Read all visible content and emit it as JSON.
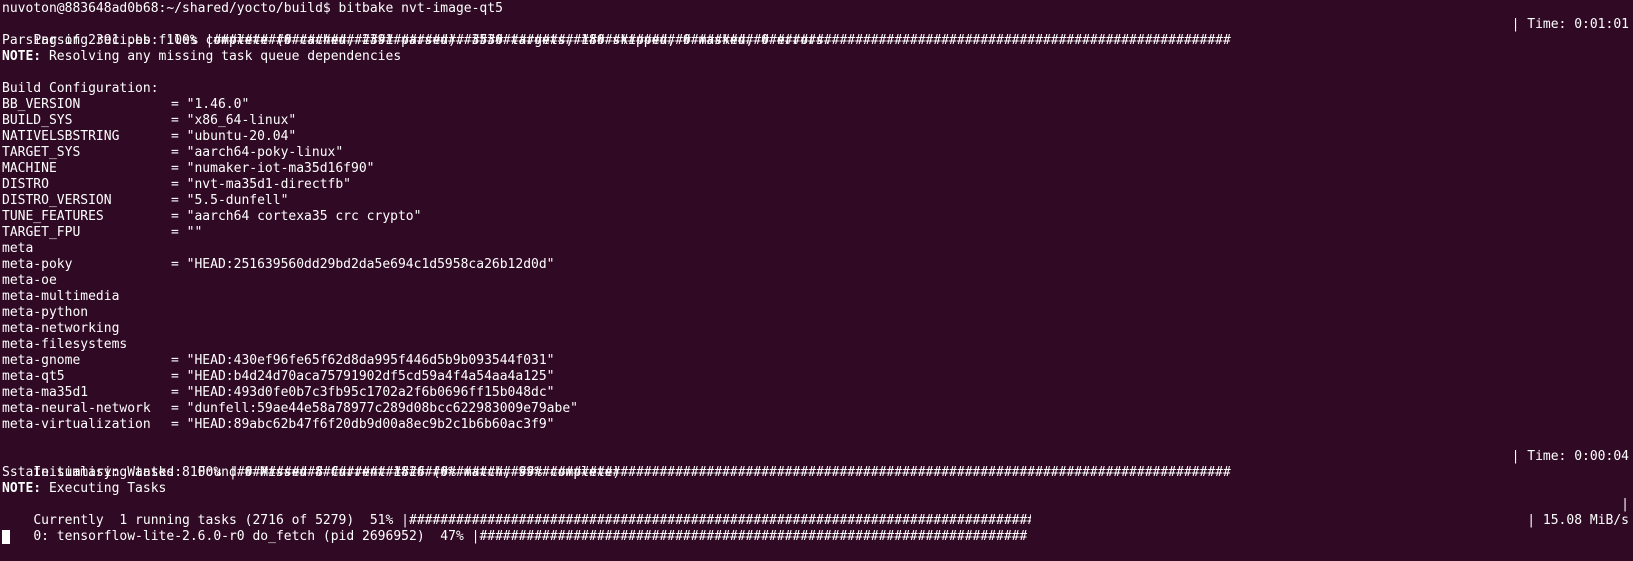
{
  "colors": {
    "background": "#300a24",
    "foreground": "#ffffff"
  },
  "prompt": "nuvoton@883648ad0b68:~/shared/yocto/build$ bitbake nvt-image-qt5",
  "parsing": {
    "label": "Parsing recipes: 100% |",
    "hashes": "##################################################################################################################################",
    "time": "| Time: 0:01:01"
  },
  "parse_summary": "Parsing of 2391 .bb files complete (0 cached, 2391 parsed). 3530 targets, 180 skipped, 0 masked, 0 errors.",
  "note1": {
    "label": "NOTE:",
    "text": " Resolving any missing task queue dependencies"
  },
  "build_config_title": "Build Configuration:",
  "config": [
    {
      "key": "BB_VERSION",
      "value": "= \"1.46.0\""
    },
    {
      "key": "BUILD_SYS",
      "value": "= \"x86_64-linux\""
    },
    {
      "key": "NATIVELSBSTRING",
      "value": "= \"ubuntu-20.04\""
    },
    {
      "key": "TARGET_SYS",
      "value": "= \"aarch64-poky-linux\""
    },
    {
      "key": "MACHINE",
      "value": "= \"numaker-iot-ma35d16f90\""
    },
    {
      "key": "DISTRO",
      "value": "= \"nvt-ma35d1-directfb\""
    },
    {
      "key": "DISTRO_VERSION",
      "value": "= \"5.5-dunfell\""
    },
    {
      "key": "TUNE_FEATURES",
      "value": "= \"aarch64 cortexa35 crc crypto\""
    },
    {
      "key": "TARGET_FPU",
      "value": "= \"\""
    },
    {
      "key": "meta",
      "value": ""
    },
    {
      "key": "meta-poky",
      "value": "= \"HEAD:251639560dd29bd2da5e694c1d5958ca26b12d0d\""
    },
    {
      "key": "meta-oe",
      "value": ""
    },
    {
      "key": "meta-multimedia",
      "value": ""
    },
    {
      "key": "meta-python",
      "value": ""
    },
    {
      "key": "meta-networking",
      "value": ""
    },
    {
      "key": "meta-filesystems",
      "value": ""
    },
    {
      "key": "meta-gnome",
      "value": "= \"HEAD:430ef96fe65f62d8da995f446d5b9b093544f031\""
    },
    {
      "key": "meta-qt5",
      "value": "= \"HEAD:b4d24d70aca75791902df5cd59a4f4a54aa4a125\""
    },
    {
      "key": "meta-ma35d1",
      "value": "= \"HEAD:493d0fe0b7c3fb95c1702a2f6b0696ff15b048dc\""
    },
    {
      "key": "meta-neural-network",
      "value": "= \"dunfell:59ae44e58a78977c289d08bcc622983009e79abe\""
    },
    {
      "key": "meta-virtualization",
      "value": "= \"HEAD:89abc62b47f6f20db9d00a8ec9b2c1b6b60ac3f9\""
    }
  ],
  "init": {
    "label": "Initialising tasks: 100% |",
    "hashes": "###############################################################################################################################",
    "time": "| Time: 0:00:04"
  },
  "sstate": "Sstate summary: Wanted 8 Found 0 Missed 8 Current 1826 (0% match, 99% complete)",
  "note2": {
    "label": "NOTE:",
    "text": " Executing Tasks"
  },
  "running": {
    "label": "Currently  1 running tasks (2716 of 5279)  51% |",
    "hashes": "##################################################################################",
    "progress": 0.51,
    "end": "|"
  },
  "task0": {
    "label": "0: tensorflow-lite-2.6.0-r0 do_fetch (pid 2696952)  47% |",
    "hashes": "##################################################################################",
    "progress": 0.47,
    "speed": "| 15.08 MiB/s"
  }
}
